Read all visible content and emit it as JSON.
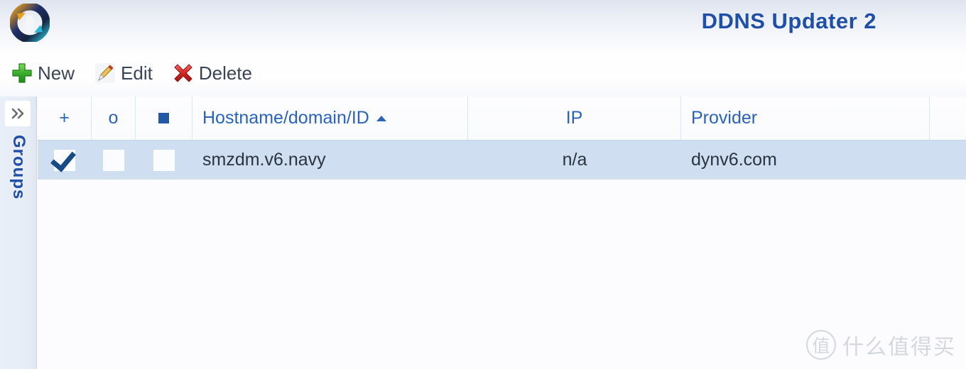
{
  "window": {
    "title": "DDNS Updater 2",
    "logo_icon": "sync-refresh-icon",
    "title_color": "#1f4fa8"
  },
  "toolbar": {
    "buttons": [
      {
        "label": "New",
        "icon": "plus-icon",
        "icon_color": "#3cae2e"
      },
      {
        "label": "Edit",
        "icon": "pencil-icon",
        "icon_color": "#e0a82e"
      },
      {
        "label": "Delete",
        "icon": "x-mark-icon",
        "icon_color": "#d42424"
      }
    ]
  },
  "sidebar": {
    "expand_icon": "double-chevron-right-icon",
    "label": "Groups"
  },
  "table": {
    "columns": [
      {
        "key": "check",
        "label": "+",
        "align": "center"
      },
      {
        "key": "o",
        "label": "o",
        "align": "center"
      },
      {
        "key": "square",
        "label": "",
        "align": "center",
        "glyph": "filled-square-icon"
      },
      {
        "key": "host",
        "label": "Hostname/domain/ID",
        "align": "left",
        "sorted": "asc"
      },
      {
        "key": "ip",
        "label": "IP",
        "align": "center"
      },
      {
        "key": "prov",
        "label": "Provider",
        "align": "left"
      },
      {
        "key": "extra",
        "label": "",
        "align": "left"
      }
    ],
    "rows": [
      {
        "check": true,
        "o": false,
        "square": false,
        "host": "smzdm.v6.navy",
        "ip": "n/a",
        "prov": "dynv6.com",
        "selected": true
      }
    ],
    "selected_row_color": "#cfdef1"
  },
  "watermark": {
    "badge": "值",
    "text": "什么值得买"
  }
}
